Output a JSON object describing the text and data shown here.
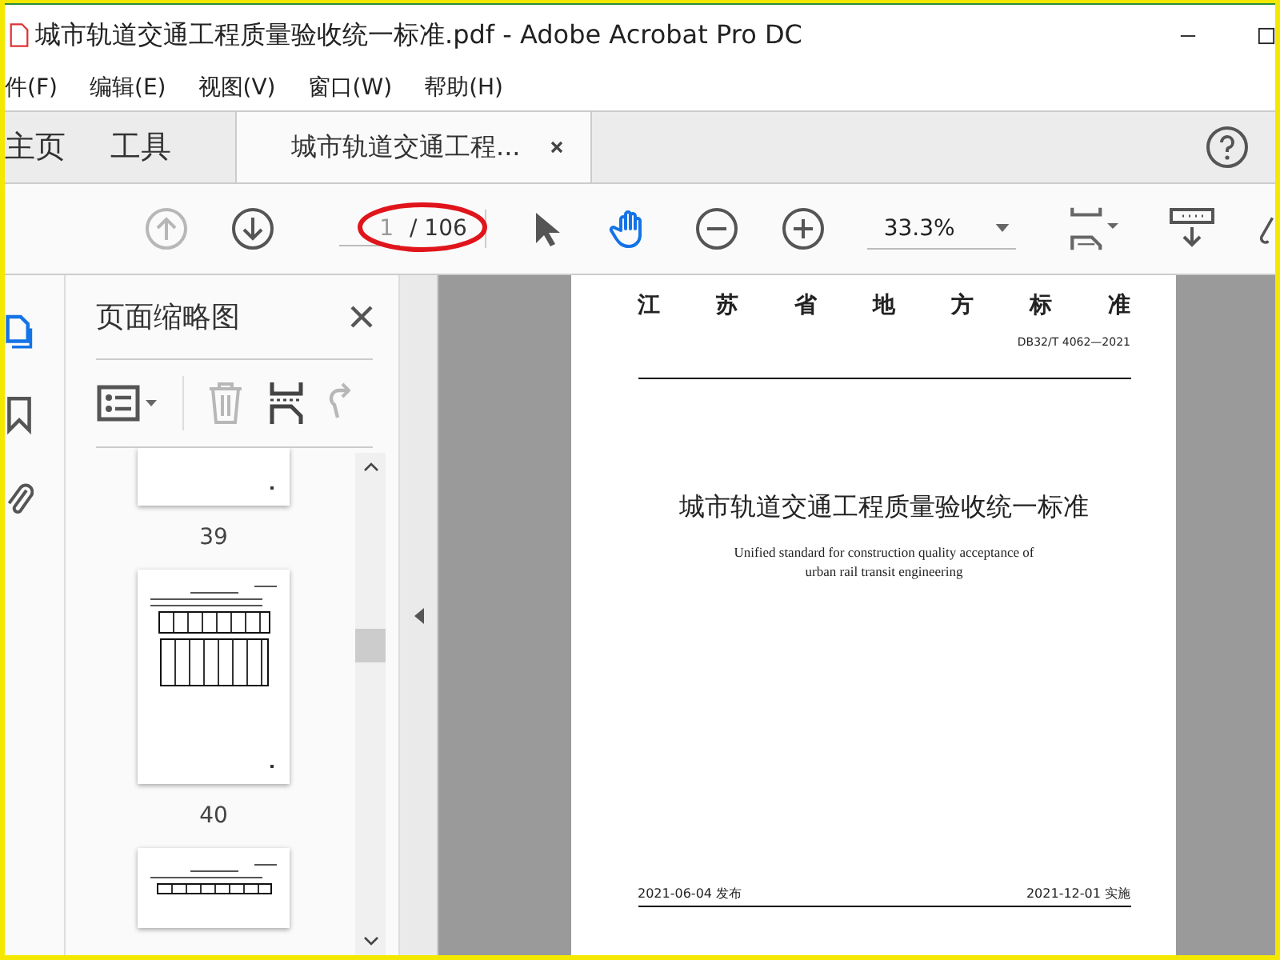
{
  "window": {
    "title": "城市轨道交通工程质量验收统一标准.pdf - Adobe Acrobat Pro DC"
  },
  "menu": {
    "items": [
      "件(F)",
      "编辑(E)",
      "视图(V)",
      "窗口(W)",
      "帮助(H)"
    ]
  },
  "tabs": [
    {
      "label": "主页",
      "selected": false
    },
    {
      "label": "工具",
      "selected": false
    },
    {
      "label": "城市轨道交通工程...",
      "selected": true
    }
  ],
  "toolbar": {
    "prev_page": {
      "disabled": true
    },
    "next_page": {
      "disabled": false
    },
    "page_field": {
      "value": "1",
      "total": "/ 106"
    },
    "tools": [
      {
        "kind": "pointer",
        "selected": false
      },
      {
        "kind": "hand",
        "selected": true
      }
    ],
    "zoom": {
      "value": "33.3%"
    }
  },
  "sidebar": {
    "rail": [
      {
        "kind": "pages",
        "selected": true
      },
      {
        "kind": "bookmarks",
        "selected": false
      },
      {
        "kind": "attachments",
        "selected": false
      }
    ],
    "panel": {
      "title": "页面缩略图",
      "delete": {
        "disabled": true
      },
      "rotate": {
        "disabled": true
      },
      "thumbnails": [
        {
          "kind": "blank",
          "label": "39"
        },
        {
          "kind": "tables",
          "label": "40"
        },
        {
          "kind": "partial"
        }
      ]
    }
  },
  "document": {
    "header": "江 苏 省 地 方 标 准",
    "code": "DB32/T 4062—2021",
    "title": "城市轨道交通工程质量验收统一标准",
    "subtitle": [
      "Unified standard for construction quality acceptance of",
      "urban rail transit engineering"
    ],
    "issued": "2021-06-04 发布",
    "effective": "2021-12-01 实施"
  }
}
